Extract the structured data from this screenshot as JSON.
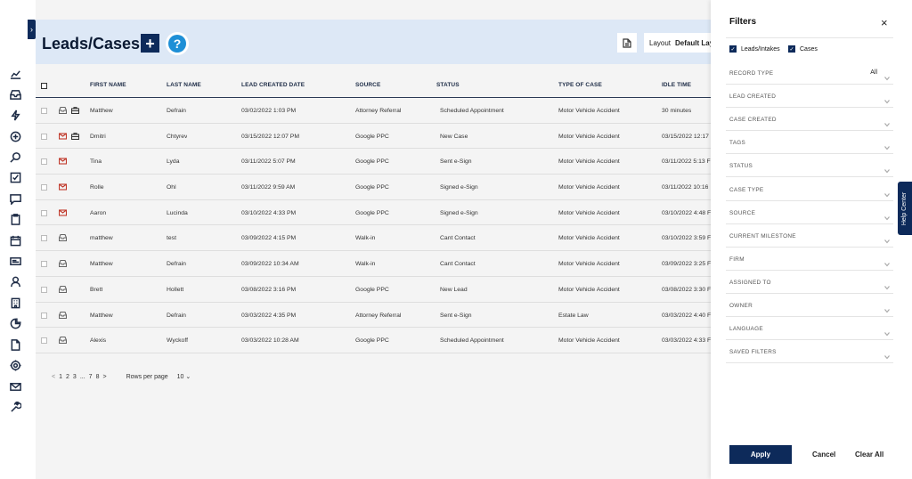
{
  "nav": {
    "toggle_glyph": "›",
    "icons": [
      "chart-icon",
      "inbox-icon",
      "bolt-icon",
      "plus-circle-icon",
      "search-icon",
      "checkbox-icon",
      "chat-icon",
      "clipboard-icon",
      "calendar-icon",
      "card-icon",
      "person-icon",
      "building-icon",
      "pie-chart-icon",
      "document-icon",
      "gear-icon",
      "mail-icon",
      "wrench-icon"
    ]
  },
  "header": {
    "title": "Leads/Cases",
    "add_glyph": "+",
    "help_glyph": "?",
    "layout_label": "Layout",
    "layout_value": "Default Layout"
  },
  "table": {
    "columns": [
      "FIRST NAME",
      "LAST NAME",
      "LEAD CREATED DATE",
      "SOURCE",
      "STATUS",
      "TYPE OF CASE",
      "IDLE TIME"
    ],
    "rows": [
      {
        "icons": [
          "inbox",
          "briefcase"
        ],
        "first": "Matthew",
        "last": "Defrain",
        "created": "03/02/2022 1:03 PM",
        "source": "Attorney Referral",
        "status": "Scheduled Appointment",
        "type": "Motor Vehicle Accident",
        "idle": "30 minutes"
      },
      {
        "icons": [
          "mail-red",
          "briefcase"
        ],
        "first": "Dmitri",
        "last": "Chtyrev",
        "created": "03/15/2022 12:07 PM",
        "source": "Google PPC",
        "status": "New Case",
        "type": "Motor Vehicle Accident",
        "idle": "03/15/2022 12:17"
      },
      {
        "icons": [
          "mail-red"
        ],
        "first": "Tina",
        "last": "Lyda",
        "created": "03/11/2022 5:07 PM",
        "source": "Google PPC",
        "status": "Sent e-Sign",
        "type": "Motor Vehicle Accident",
        "idle": "03/11/2022 5:13 F"
      },
      {
        "icons": [
          "mail-red"
        ],
        "first": "Rolle",
        "last": "Ohl",
        "created": "03/11/2022 9:59 AM",
        "source": "Google PPC",
        "status": "Signed e-Sign",
        "type": "Motor Vehicle Accident",
        "idle": "03/11/2022 10:16"
      },
      {
        "icons": [
          "mail-red"
        ],
        "first": "Aaron",
        "last": "Lucinda",
        "created": "03/10/2022 4:33 PM",
        "source": "Google PPC",
        "status": "Signed e-Sign",
        "type": "Motor Vehicle Accident",
        "idle": "03/10/2022 4:48 F"
      },
      {
        "icons": [
          "inbox"
        ],
        "first": "matthew",
        "last": "test",
        "created": "03/09/2022 4:15 PM",
        "source": "Walk-in",
        "status": "Cant Contact",
        "type": "Motor Vehicle Accident",
        "idle": "03/10/2022 3:59 F"
      },
      {
        "icons": [
          "inbox"
        ],
        "first": "Matthew",
        "last": "Defrain",
        "created": "03/09/2022 10:34 AM",
        "source": "Walk-in",
        "status": "Cant Contact",
        "type": "Motor Vehicle Accident",
        "idle": "03/09/2022 3:25 F"
      },
      {
        "icons": [
          "inbox"
        ],
        "first": "Brett",
        "last": "Hollett",
        "created": "03/08/2022 3:16 PM",
        "source": "Google PPC",
        "status": "New Lead",
        "type": "Motor Vehicle Accident",
        "idle": "03/08/2022 3:30 F"
      },
      {
        "icons": [
          "inbox"
        ],
        "first": "Matthew",
        "last": "Defrain",
        "created": "03/03/2022 4:35 PM",
        "source": "Attorney Referral",
        "status": "Sent e-Sign",
        "type": "Estate Law",
        "idle": "03/03/2022 4:40 F"
      },
      {
        "icons": [
          "inbox"
        ],
        "first": "Alexis",
        "last": "Wyckoff",
        "created": "03/03/2022 10:28 AM",
        "source": "Google PPC",
        "status": "Scheduled Appointment",
        "type": "Motor Vehicle Accident",
        "idle": "03/03/2022 4:33 F"
      }
    ]
  },
  "pagination": {
    "prev": "<",
    "pages": [
      "1",
      "2",
      "3",
      "...",
      "7",
      "8"
    ],
    "next": ">",
    "rows_label": "Rows per page",
    "rows_value": "10 ⌄"
  },
  "filters": {
    "title": "Filters",
    "close_glyph": "×",
    "checkboxes": [
      {
        "label": "Leads/Intakes",
        "checked": true
      },
      {
        "label": "Cases",
        "checked": true
      }
    ],
    "rows": [
      {
        "label": "RECORD TYPE",
        "value": "All"
      },
      {
        "label": "LEAD CREATED",
        "value": ""
      },
      {
        "label": "CASE CREATED",
        "value": ""
      },
      {
        "label": "TAGS",
        "value": ""
      },
      {
        "label": "STATUS",
        "value": ""
      },
      {
        "label": "CASE TYPE",
        "value": ""
      },
      {
        "label": "SOURCE",
        "value": ""
      },
      {
        "label": "CURRENT MILESTONE",
        "value": ""
      },
      {
        "label": "FIRM",
        "value": ""
      },
      {
        "label": "ASSIGNED TO",
        "value": ""
      },
      {
        "label": "OWNER",
        "value": ""
      },
      {
        "label": "LANGUAGE",
        "value": ""
      },
      {
        "label": "SAVED FILTERS",
        "value": ""
      }
    ],
    "apply_label": "Apply",
    "cancel_label": "Cancel",
    "clear_label": "Clear All"
  },
  "help_center": {
    "label": "Help Center"
  },
  "colors": {
    "navy": "#0d2a5a",
    "header_bg": "#dde8f6",
    "help_blue": "#1e8fd6",
    "mail_red": "#c0392b"
  }
}
